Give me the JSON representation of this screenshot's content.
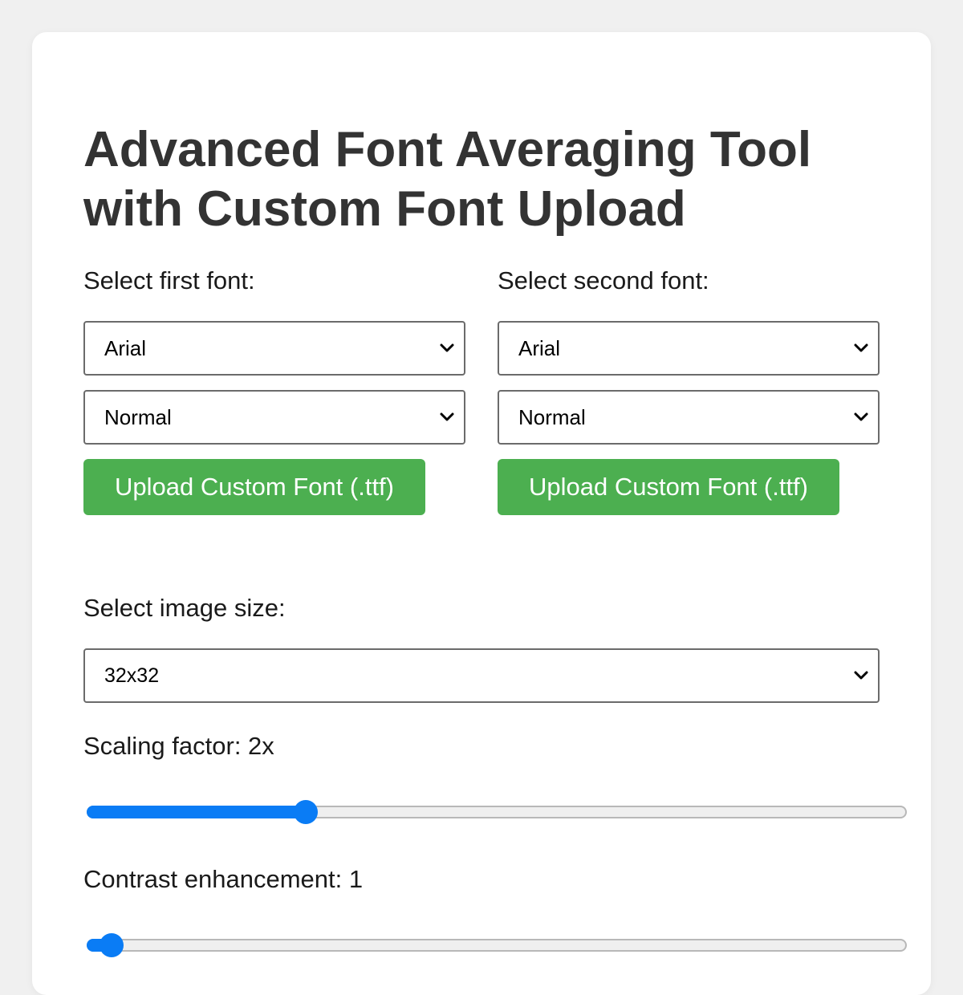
{
  "title": "Advanced Font Averaging Tool with Custom Font Upload",
  "first_font": {
    "label": "Select first font:",
    "family_value": "Arial",
    "style_value": "Normal",
    "upload_label": "Upload Custom Font (.ttf)"
  },
  "second_font": {
    "label": "Select second font:",
    "family_value": "Arial",
    "style_value": "Normal",
    "upload_label": "Upload Custom Font (.ttf)"
  },
  "image_size": {
    "label": "Select image size:",
    "value": "32x32"
  },
  "scaling": {
    "label": "Scaling factor: 2x",
    "level_fraction": 0.267
  },
  "contrast": {
    "label": "Contrast enhancement: 1",
    "level_fraction": 0.03
  },
  "colors": {
    "accent": "#0a7cf5",
    "upload_button": "#4caf50",
    "title": "#333333",
    "background": "#f0f0f0"
  },
  "icons": {
    "dropdown": "chevron-down-icon"
  }
}
